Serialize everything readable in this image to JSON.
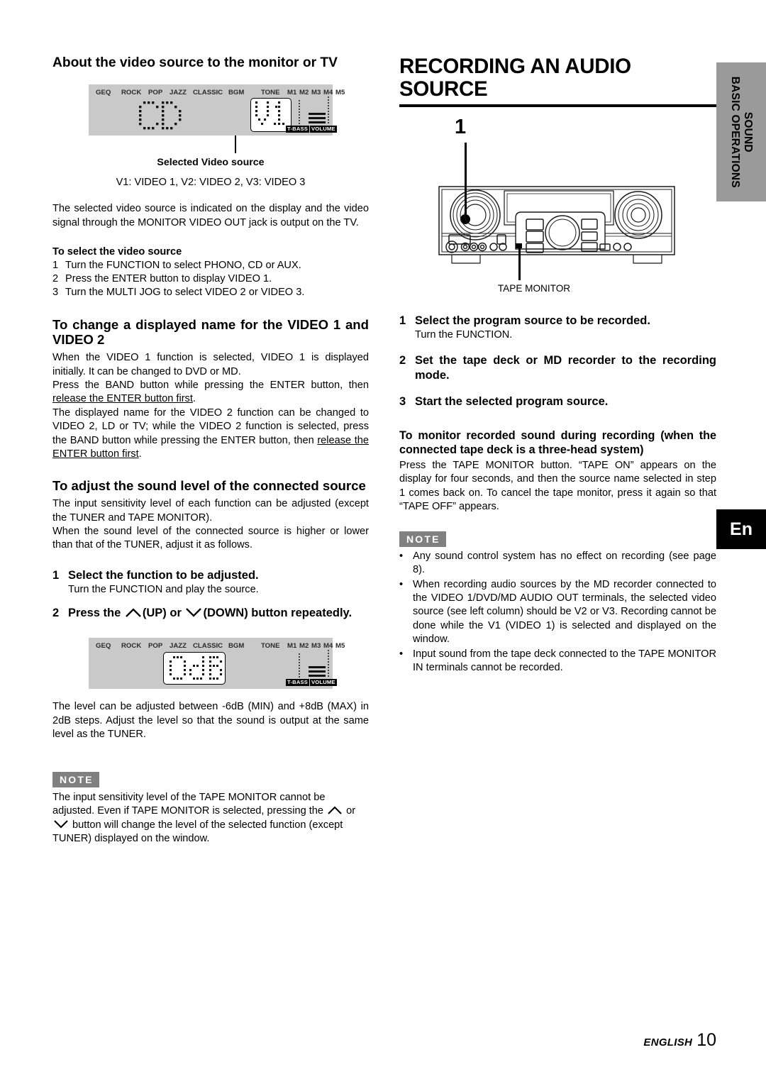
{
  "side_tab": {
    "line1": "SOUND",
    "line2": "BASIC OPERATIONS"
  },
  "lang_tab": {
    "label": "En"
  },
  "footer": {
    "language": "ENGLISH",
    "page": "10"
  },
  "left": {
    "heading": "About the video source to the monitor or TV",
    "display": {
      "labels": [
        "GEQ",
        "ROCK",
        "POP",
        "JAZZ",
        "CLASSIC",
        "BGM",
        "TONE",
        "M1",
        "M2",
        "M3",
        "M4",
        "M5"
      ],
      "main_text": "CD",
      "highlight_text": "V1",
      "badges": [
        "T-BASS",
        "VOLUME"
      ]
    },
    "caption": "Selected Video source",
    "legend": "V1: VIDEO 1, V2: VIDEO 2, V3: VIDEO 3",
    "intro": "The selected video source is indicated on the display and the video signal through the MONITOR VIDEO OUT jack is output on the TV.",
    "select_head": "To select the video source",
    "select_steps": [
      {
        "num": "1",
        "text": "Turn the FUNCTION to select PHONO, CD or AUX."
      },
      {
        "num": "2",
        "text": "Press the ENTER button to display VIDEO 1."
      },
      {
        "num": "3",
        "text": "Turn the MULTI JOG to select VIDEO 2 or VIDEO 3."
      }
    ],
    "rename_head": "To change a displayed name for the VIDEO 1 and VIDEO 2",
    "rename_p1": "When the VIDEO 1 function is selected, VIDEO 1 is displayed initially. It can be changed to DVD or MD.",
    "rename_p2_a": "Press the BAND button while pressing the ENTER button, then ",
    "rename_p2_u": "release the ENTER button first",
    "rename_p2_b": ".",
    "rename_p3_a": "The displayed name for the VIDEO 2 function can be changed to  VIDEO 2, LD or TV; while the VIDEO 2 function is selected, press the BAND button while pressing the ENTER button, then ",
    "rename_p3_u": "release the ENTER button first",
    "rename_p3_b": ".",
    "level_head": "To adjust the sound level of the connected source",
    "level_p1": "The input sensitivity level of each function can be adjusted (except the TUNER and TAPE MONITOR).",
    "level_p2": "When the sound level of the connected source is higher or lower than that of the TUNER, adjust it as follows.",
    "level_step1_num": "1",
    "level_step1_head": "Select the function to be adjusted.",
    "level_step1_sub": "Turn the FUNCTION and play the source.",
    "level_step2_num": "2",
    "level_step2_a": "Press  the ",
    "level_step2_b": "(UP)  or ",
    "level_step2_c": "(DOWN)  button repeatedly.",
    "display2": {
      "labels": [
        "GEQ",
        "ROCK",
        "POP",
        "JAZZ",
        "CLASSIC",
        "BGM",
        "TONE",
        "M1",
        "M2",
        "M3",
        "M4",
        "M5"
      ],
      "main_text": "0dB",
      "badges": [
        "T-BASS",
        "VOLUME"
      ]
    },
    "level_outro": "The level can be adjusted between -6dB (MIN) and +8dB (MAX) in 2dB steps. Adjust the level so that the sound is output at the same level as the TUNER.",
    "note_badge": "NOTE",
    "note_a": "The input sensitivity level of the TAPE MONITOR cannot be adjusted. Even if TAPE MONITOR is selected, pressing the ",
    "note_b": " or ",
    "note_c": " button will change the level of the selected function (except TUNER) displayed on the window."
  },
  "right": {
    "title": "RECORDING AN AUDIO SOURCE",
    "callout_number": "1",
    "callout_label": "TAPE MONITOR",
    "steps": [
      {
        "num": "1",
        "head": "Select the program source to be recorded.",
        "sub": "Turn the FUNCTION."
      },
      {
        "num": "2",
        "head": "Set the tape deck or MD recorder to the recording mode.",
        "sub": ""
      },
      {
        "num": "3",
        "head": "Start the selected program source.",
        "sub": ""
      }
    ],
    "monitor_head": "To monitor recorded sound during recording (when the connected tape deck is a three-head system)",
    "monitor_body": "Press the TAPE MONITOR button. “TAPE ON” appears on the display for four seconds, and then the source name selected in step 1 comes back on. To cancel the tape monitor, press it again so that “TAPE OFF” appears.",
    "note_badge": "NOTE",
    "notes": [
      "Any sound control system has no effect on recording (see page 8).",
      "When recording audio sources by the MD recorder connected to the VIDEO 1/DVD/MD AUDIO OUT terminals, the selected video source (see left column) should be V2 or V3. Recording cannot be done while the V1 (VIDEO 1) is selected and displayed on the window.",
      "Input sound from the tape deck connected to the TAPE MONITOR IN terminals cannot be recorded."
    ]
  }
}
